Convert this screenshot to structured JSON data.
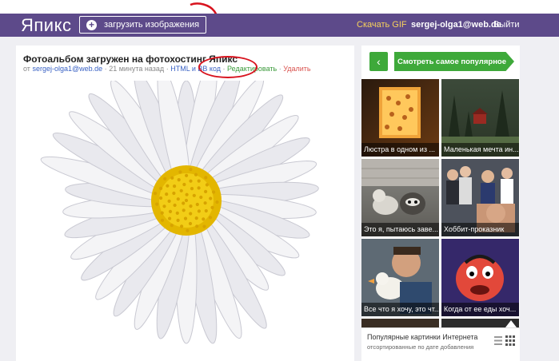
{
  "header": {
    "logo": "Япикс",
    "upload_label": "загрузить изображения",
    "gif_link": "Скачать GIF",
    "user_email": "sergej-olga1@web.de",
    "logout": "Выйти",
    "bg_color": "#5d4a8a"
  },
  "main": {
    "title": "Фотоальбом загружен на фотохостинг Япикс",
    "meta": {
      "prefix": "от",
      "author": "sergej-olga1@web.de",
      "sep1": "·",
      "time": "21 минута назад",
      "sep2": "·",
      "html_link": "HTML и BB код",
      "sep3": "·",
      "edit_link": "Редактировать",
      "sep4": "·",
      "delete_link": "Удалить"
    }
  },
  "sidebar": {
    "popular_button": "Смотреть самое популярное",
    "back_icon": "chevron-left-icon",
    "tiles": [
      {
        "caption": "Люстра в одном из ..."
      },
      {
        "caption": "Маленькая мечта ин..."
      },
      {
        "caption": "Это я, пытаюсь заве..."
      },
      {
        "caption": "Хоббит-проказник"
      },
      {
        "caption": "Все что я хочу, это чт..."
      },
      {
        "caption": "Когда от ее еды хоч..."
      }
    ],
    "footer_title": "Популярные картинки Интернета",
    "footer_sub": "отсортированные по дате добавления",
    "accent_color": "#3ea93a"
  }
}
